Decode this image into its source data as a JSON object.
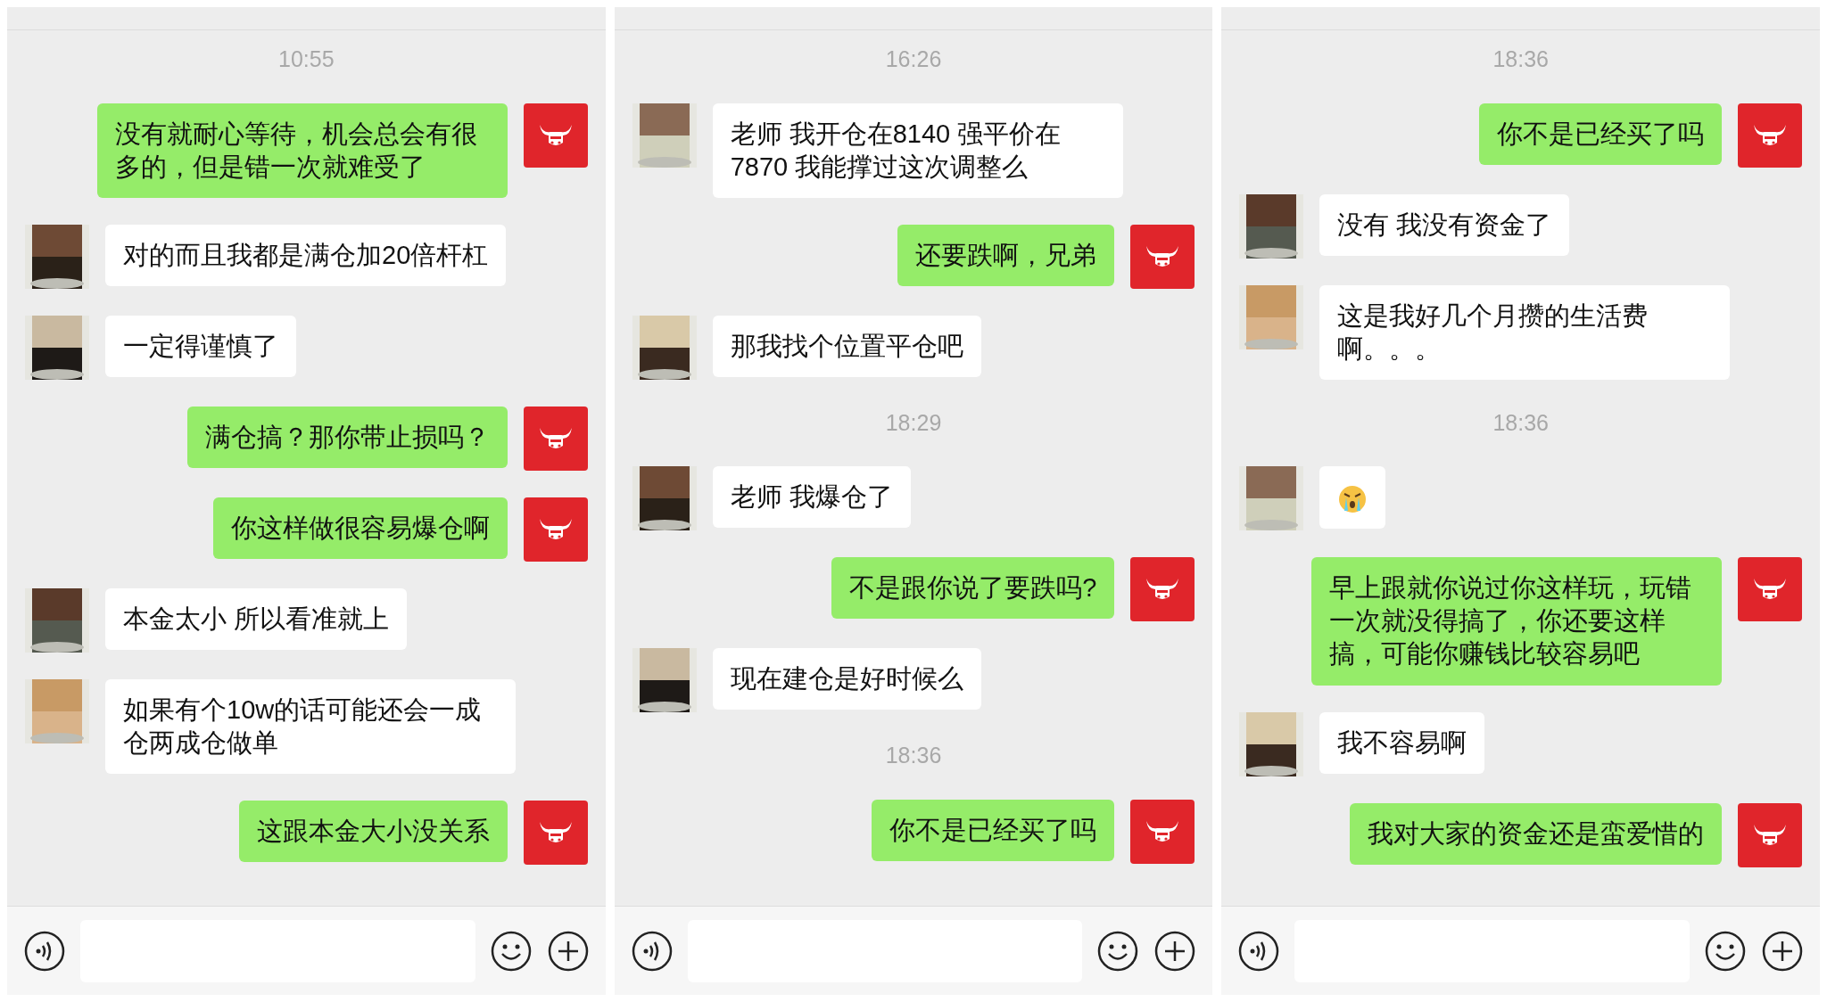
{
  "panels": [
    {
      "messages": [
        {
          "kind": "time",
          "text": "10:55"
        },
        {
          "kind": "out",
          "text": "没有就耐心等待，机会总会有很多的，但是错一次就难受了"
        },
        {
          "kind": "in",
          "text": "对的而且我都是满仓加20倍杆杠"
        },
        {
          "kind": "in",
          "text": "一定得谨慎了"
        },
        {
          "kind": "out",
          "text": "满仓搞？那你带止损吗？"
        },
        {
          "kind": "out",
          "text": "你这样做很容易爆仓啊"
        },
        {
          "kind": "in",
          "text": "本金太小 所以看准就上"
        },
        {
          "kind": "in",
          "text": "如果有个10w的话可能还会一成仓两成仓做单"
        },
        {
          "kind": "out",
          "text": "这跟本金大小没关系"
        }
      ]
    },
    {
      "messages": [
        {
          "kind": "time",
          "text": "16:26"
        },
        {
          "kind": "in",
          "text": "老师 我开仓在8140 强平价在7870 我能撑过这次调整么"
        },
        {
          "kind": "out",
          "text": "还要跌啊，兄弟"
        },
        {
          "kind": "in",
          "text": "那我找个位置平仓吧"
        },
        {
          "kind": "time",
          "text": "18:29"
        },
        {
          "kind": "in",
          "text": "老师 我爆仓了"
        },
        {
          "kind": "out",
          "text": "不是跟你说了要跌吗?"
        },
        {
          "kind": "in",
          "text": "现在建仓是好时候么"
        },
        {
          "kind": "time",
          "text": "18:36"
        },
        {
          "kind": "out",
          "text": "你不是已经买了吗"
        }
      ]
    },
    {
      "messages": [
        {
          "kind": "time",
          "text": "18:36"
        },
        {
          "kind": "out",
          "text": "你不是已经买了吗"
        },
        {
          "kind": "in",
          "text": "没有 我没有资金了"
        },
        {
          "kind": "in",
          "text": "这是我好几个月攒的生活费啊。。。"
        },
        {
          "kind": "time",
          "text": "18:36"
        },
        {
          "kind": "sticker"
        },
        {
          "kind": "out",
          "text": "早上跟就你说过你这样玩，玩错一次就没得搞了，你还要这样搞，可能你赚钱比较容易吧"
        },
        {
          "kind": "in",
          "text": "我不容易啊"
        },
        {
          "kind": "out",
          "text": "我对大家的资金还是蛮爱惜的"
        }
      ]
    }
  ]
}
